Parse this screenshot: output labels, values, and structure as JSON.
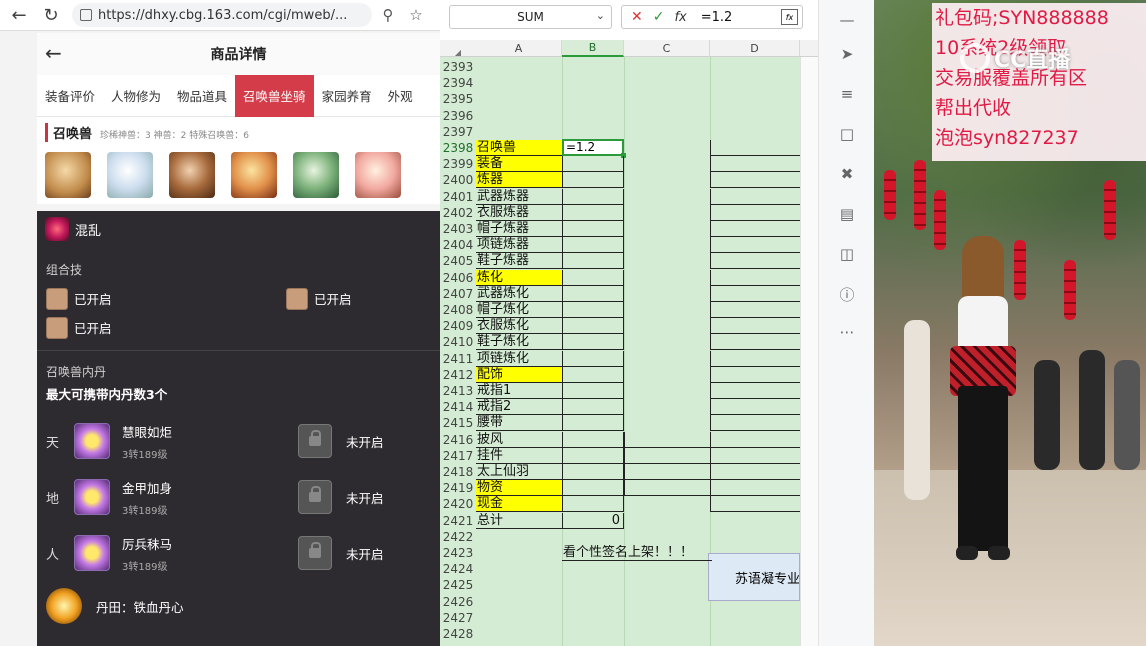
{
  "browser": {
    "url": "https://dhxy.cbg.163.com/cgi/mweb/...",
    "page_title": "商品详情",
    "tabs": [
      "装备评价",
      "人物修为",
      "物品道具",
      "召唤兽坐骑",
      "家园养育",
      "外观"
    ],
    "active_tab": 3,
    "summon_section": {
      "title": "召唤兽",
      "stats": "珍稀神兽：3   神兽：2   特殊召唤兽：6"
    },
    "skill": {
      "name": "混乱"
    },
    "combo": {
      "title": "组合技",
      "items": [
        "已开启",
        "已开启",
        "已开启"
      ]
    },
    "neidan": {
      "title": "召唤兽内丹",
      "max": "最大可携带内丹数3个",
      "rows": [
        {
          "key": "天",
          "name": "慧眼如炬",
          "level": "3转189级",
          "locked": "未开启"
        },
        {
          "key": "地",
          "name": "金甲加身",
          "level": "3转189级",
          "locked": "未开启"
        },
        {
          "key": "人",
          "name": "厉兵秣马",
          "level": "3转189级",
          "locked": "未开启"
        }
      ],
      "dantian": "丹田：铁血丹心"
    }
  },
  "sheet": {
    "name_box": "SUM",
    "formula": "=1.2",
    "columns": [
      "A",
      "B",
      "C",
      "D"
    ],
    "selected_column": "B",
    "rows": [
      {
        "n": "2393",
        "a": ""
      },
      {
        "n": "2394",
        "a": ""
      },
      {
        "n": "2395",
        "a": ""
      },
      {
        "n": "2396",
        "a": ""
      },
      {
        "n": "2397",
        "a": ""
      },
      {
        "n": "2398",
        "a": "召唤兽",
        "y": true,
        "b": "=1.2"
      },
      {
        "n": "2399",
        "a": "装备",
        "y": true
      },
      {
        "n": "2400",
        "a": "炼器",
        "y": true
      },
      {
        "n": "2401",
        "a": "武器炼器"
      },
      {
        "n": "2402",
        "a": "衣服炼器"
      },
      {
        "n": "2403",
        "a": "帽子炼器"
      },
      {
        "n": "2404",
        "a": "项链炼器"
      },
      {
        "n": "2405",
        "a": "鞋子炼器"
      },
      {
        "n": "2406",
        "a": "炼化",
        "y": true
      },
      {
        "n": "2407",
        "a": "武器炼化"
      },
      {
        "n": "2408",
        "a": "帽子炼化"
      },
      {
        "n": "2409",
        "a": "衣服炼化"
      },
      {
        "n": "2410",
        "a": "鞋子炼化"
      },
      {
        "n": "2411",
        "a": "项链炼化"
      },
      {
        "n": "2412",
        "a": "配饰",
        "y": true
      },
      {
        "n": "2413",
        "a": "戒指1"
      },
      {
        "n": "2414",
        "a": "戒指2"
      },
      {
        "n": "2415",
        "a": "腰带"
      },
      {
        "n": "2416",
        "a": "披风"
      },
      {
        "n": "2417",
        "a": "挂件"
      },
      {
        "n": "2418",
        "a": "太上仙羽"
      },
      {
        "n": "2419",
        "a": "物资",
        "y": true
      },
      {
        "n": "2420",
        "a": "现金",
        "y": true
      },
      {
        "n": "2421",
        "a": "总计",
        "b": "0"
      },
      {
        "n": "2422",
        "a": ""
      },
      {
        "n": "2423",
        "a": "",
        "b": "看个性签名上架！！！"
      },
      {
        "n": "2424",
        "a": ""
      },
      {
        "n": "2425",
        "a": ""
      },
      {
        "n": "2426",
        "a": ""
      },
      {
        "n": "2427",
        "a": ""
      },
      {
        "n": "2428",
        "a": ""
      }
    ],
    "d_box_text": "苏语凝专业"
  },
  "stream": {
    "promo_lines": [
      "礼包码;SYN888888",
      "10系统2级领取",
      "交易服覆盖所有区",
      "帮出代收",
      "泡泡syn827237"
    ],
    "logo": "CC直播"
  }
}
